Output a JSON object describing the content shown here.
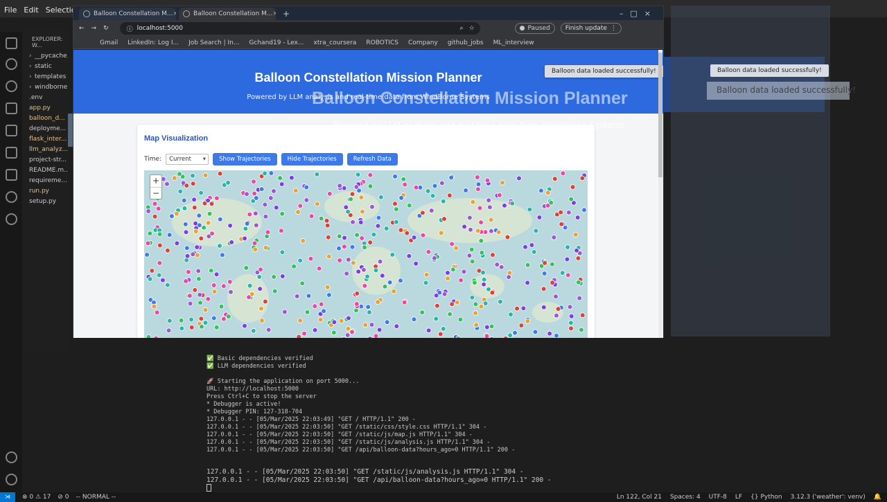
{
  "menubar": [
    "File",
    "Edit",
    "Selection"
  ],
  "explorer": {
    "title": "EXPLORER: W...",
    "items": [
      {
        "name": "__pycache...",
        "folder": true,
        "color": "#cccccc"
      },
      {
        "name": "static",
        "folder": true,
        "color": "#cccccc"
      },
      {
        "name": "templates",
        "folder": true,
        "color": "#cccccc"
      },
      {
        "name": "windborne...",
        "folder": true,
        "color": "#cccccc"
      },
      {
        "name": ".env",
        "folder": false,
        "color": "#cccccc"
      },
      {
        "name": "app.py",
        "folder": false,
        "color": "#e2c08d"
      },
      {
        "name": "balloon_d...",
        "folder": false,
        "color": "#e2c08d"
      },
      {
        "name": "deployme...",
        "folder": false,
        "color": "#cccccc"
      },
      {
        "name": "flask_inter...",
        "folder": false,
        "color": "#e2c08d"
      },
      {
        "name": "llm_analyz...",
        "folder": false,
        "color": "#e2c08d"
      },
      {
        "name": "project-str...",
        "folder": false,
        "color": "#cccccc"
      },
      {
        "name": "README.m...",
        "folder": false,
        "color": "#cccccc"
      },
      {
        "name": "requireme...",
        "folder": false,
        "color": "#cccccc"
      },
      {
        "name": "run.py",
        "folder": false,
        "color": "#e2c08d"
      },
      {
        "name": "setup.py",
        "folder": false,
        "color": "#cccccc"
      }
    ]
  },
  "browser": {
    "tabs": [
      {
        "label": "Balloon Constellation M...",
        "active": false
      },
      {
        "label": "Balloon Constellation M...",
        "active": true
      }
    ],
    "new_tab": "+",
    "address": "localhost:5000",
    "paused_label": "Paused",
    "finish_update_label": "Finish update",
    "bookmarks": [
      "Gmail",
      "LinkedIn: Log I...",
      "Job Search | In...",
      "Gchand19 - Lex...",
      "xtra_coursera",
      "ROBOTICS",
      "Company",
      "github_jobs",
      "ML_interview"
    ]
  },
  "app": {
    "title": "Balloon Constellation Mission Planner",
    "subtitle": "Powered by LLM analysis and real-time data from WindBorne Systems",
    "toast": "Balloon data loaded successfully!",
    "section_title": "Map Visualization",
    "time_label": "Time:",
    "time_value": "Current",
    "buttons": {
      "show": "Show Trajectories",
      "hide": "Hide Trajectories",
      "refresh": "Refresh Data"
    },
    "zoom_in": "+",
    "zoom_out": "−"
  },
  "ghost": {
    "toast": "Balloon data loaded successfully!",
    "toast_large": "Balloon data loaded successfully!",
    "title": "Balloon Constellation Mission Planner",
    "subtitle": "Powered by LLM analysis and real-time data from WindBorne Systems"
  },
  "terminal_ghost": [
    "✅ Basic dependencies verified",
    "✅ LLM dependencies verified",
    "",
    "🚀 Starting the application on port 5000...",
    "   URL: http://localhost:5000",
    "   Press Ctrl+C to stop the server",
    " * Debugger is active!",
    " * Debugger PIN: 127-318-704",
    "127.0.0.1 - - [05/Mar/2025 22:03:49] \"GET / HTTP/1.1\" 200 -",
    "127.0.0.1 - - [05/Mar/2025 22:03:50] \"GET /static/css/style.css HTTP/1.1\" 304 -",
    "127.0.0.1 - - [05/Mar/2025 22:03:50] \"GET /static/js/map.js HTTP/1.1\" 304 -",
    "127.0.0.1 - - [05/Mar/2025 22:03:50] \"GET /static/js/analysis.js HTTP/1.1\" 304 -",
    "127.0.0.1 - - [05/Mar/2025 22:03:50] \"GET /api/balloon-data?hours_ago=0 HTTP/1.1\" 200 -"
  ],
  "terminal": [
    "127.0.0.1 - - [05/Mar/2025 22:03:50] \"GET /static/js/analysis.js HTTP/1.1\" 304 -",
    "127.0.0.1 - - [05/Mar/2025 22:03:50] \"GET /api/balloon-data?hours_ago=0 HTTP/1.1\" 200 -"
  ],
  "statusbar": {
    "errors": "⊗ 0 ⚠ 17",
    "ports": "⊘ 0",
    "mode": "-- NORMAL --",
    "position": "Ln 122, Col 21",
    "spaces": "Spaces: 4",
    "encoding": "UTF-8",
    "eol": "LF",
    "language": "{} Python",
    "interpreter": "3.12.3 ('weather': venv)"
  },
  "colors": {
    "header_blue": "#2d6ae0",
    "button_blue": "#3d7ae8",
    "map_water": "#b9d9df",
    "balloon_palette": [
      "#7b3fe4",
      "#2bb5a8",
      "#e64aa4",
      "#3f7be6",
      "#36c060",
      "#e8a23a",
      "#d8433a",
      "#9b59d0"
    ]
  }
}
